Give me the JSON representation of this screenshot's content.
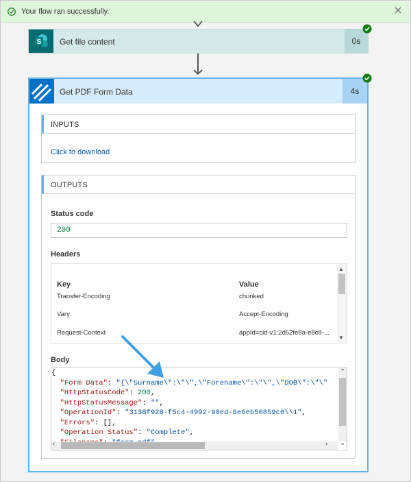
{
  "banner": {
    "message": "Your flow ran successfully.",
    "status_color": "#dff6dd"
  },
  "actions": [
    {
      "title": "Get file content",
      "duration": "0s",
      "icon": "sharepoint-icon",
      "status": "success"
    },
    {
      "title": "Get PDF Form Data",
      "duration": "4s",
      "icon": "encodian-icon",
      "status": "success"
    }
  ],
  "inputs": {
    "heading": "INPUTS",
    "link_text": "Click to download"
  },
  "outputs": {
    "heading": "OUTPUTS",
    "status_code_label": "Status code",
    "status_code": "200",
    "headers_label": "Headers",
    "headers_columns": [
      "Key",
      "Value"
    ],
    "headers_rows": [
      {
        "key": "Transfer-Encoding",
        "value": "chunked"
      },
      {
        "key": "Vary",
        "value": "Accept-Encoding"
      },
      {
        "key": "Request-Context",
        "value": "appId=cid-v1:2d52fe8a-e8c8-..."
      }
    ],
    "body_label": "Body",
    "body_lines": [
      "{",
      "  \"Form Data\": \"{\\\"Surname\\\":\\\"\\\",\\\"Forename\\\":\\\"\\\",\\\"DOB\\\":\\\"\\\"",
      "  \"HttpStatusCode\": 200,",
      "  \"HttpStatusMessage\": \"\",",
      "  \"OperationId\": \"3138f928-f5c4-4992-90ed-6e6eb50859c0\\\\1\",",
      "  \"Errors\": [],",
      "  \"Operation Status\": \"Complete\",",
      "  \"Filename\": \"form.pdf\""
    ]
  },
  "colors": {
    "accent": "#0072c6",
    "sharepoint": "#036c70",
    "success": "#107c10"
  }
}
